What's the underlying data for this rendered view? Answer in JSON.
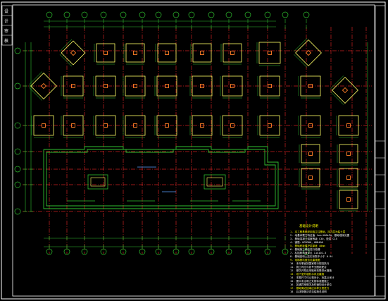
{
  "drawing": {
    "palette": {
      "background": "#000000",
      "frame": "#ffffff",
      "footing": "#ffff66",
      "column": "#ff7f27",
      "axis": "#cc2222",
      "dimension": "#2fbf2f",
      "wall": "#2fbf2f",
      "note_text": "#ffffff",
      "note_hilite": "#ffff00",
      "arrow": "#5aa0ff"
    },
    "title_block_left": [
      "设",
      "计",
      "审",
      "核"
    ],
    "title_block_right": [
      "工程名称",
      "图名",
      "图号",
      "比例",
      "日期",
      "设计",
      "校对",
      "审核",
      "审定"
    ],
    "notes": {
      "title": "基础设计说明",
      "items": [
        "1. 本工程基础采用独立柱基础，持力层为粘土层",
        "2. 地基承载力特征值 fak=180kPa，基础埋深见图",
        "3. 基础混凝土强度等级 C30，垫层 C15",
        "4. 钢筋：HPB300，HRB400",
        "5. 基础底板保护层厚度 40mm",
        "6. 基础施工前应进行验槽",
        "7. 柱插筋构造详见 11G101-3",
        "8. 基础回填土压实系数不小于 0.94",
        "9. 电梯基坑做法见建施图",
        "10. 未尽事宜按国家现行规范执行",
        "11. 施工时应与各专业图纸配合",
        "12. 基坑开挖应采取有效降排水措施",
        "13. 地下室外墙防水详见建施",
        "14. 本图尺寸均以毫米计，标高以米计",
        "15. 图中未注明之处按标准图施工",
        "16. 如遇异常情况及时通知设计单位",
        "17. 基础周边回填应对称分层进行",
        "18. 后浇带做法详见结施总说明"
      ]
    }
  }
}
